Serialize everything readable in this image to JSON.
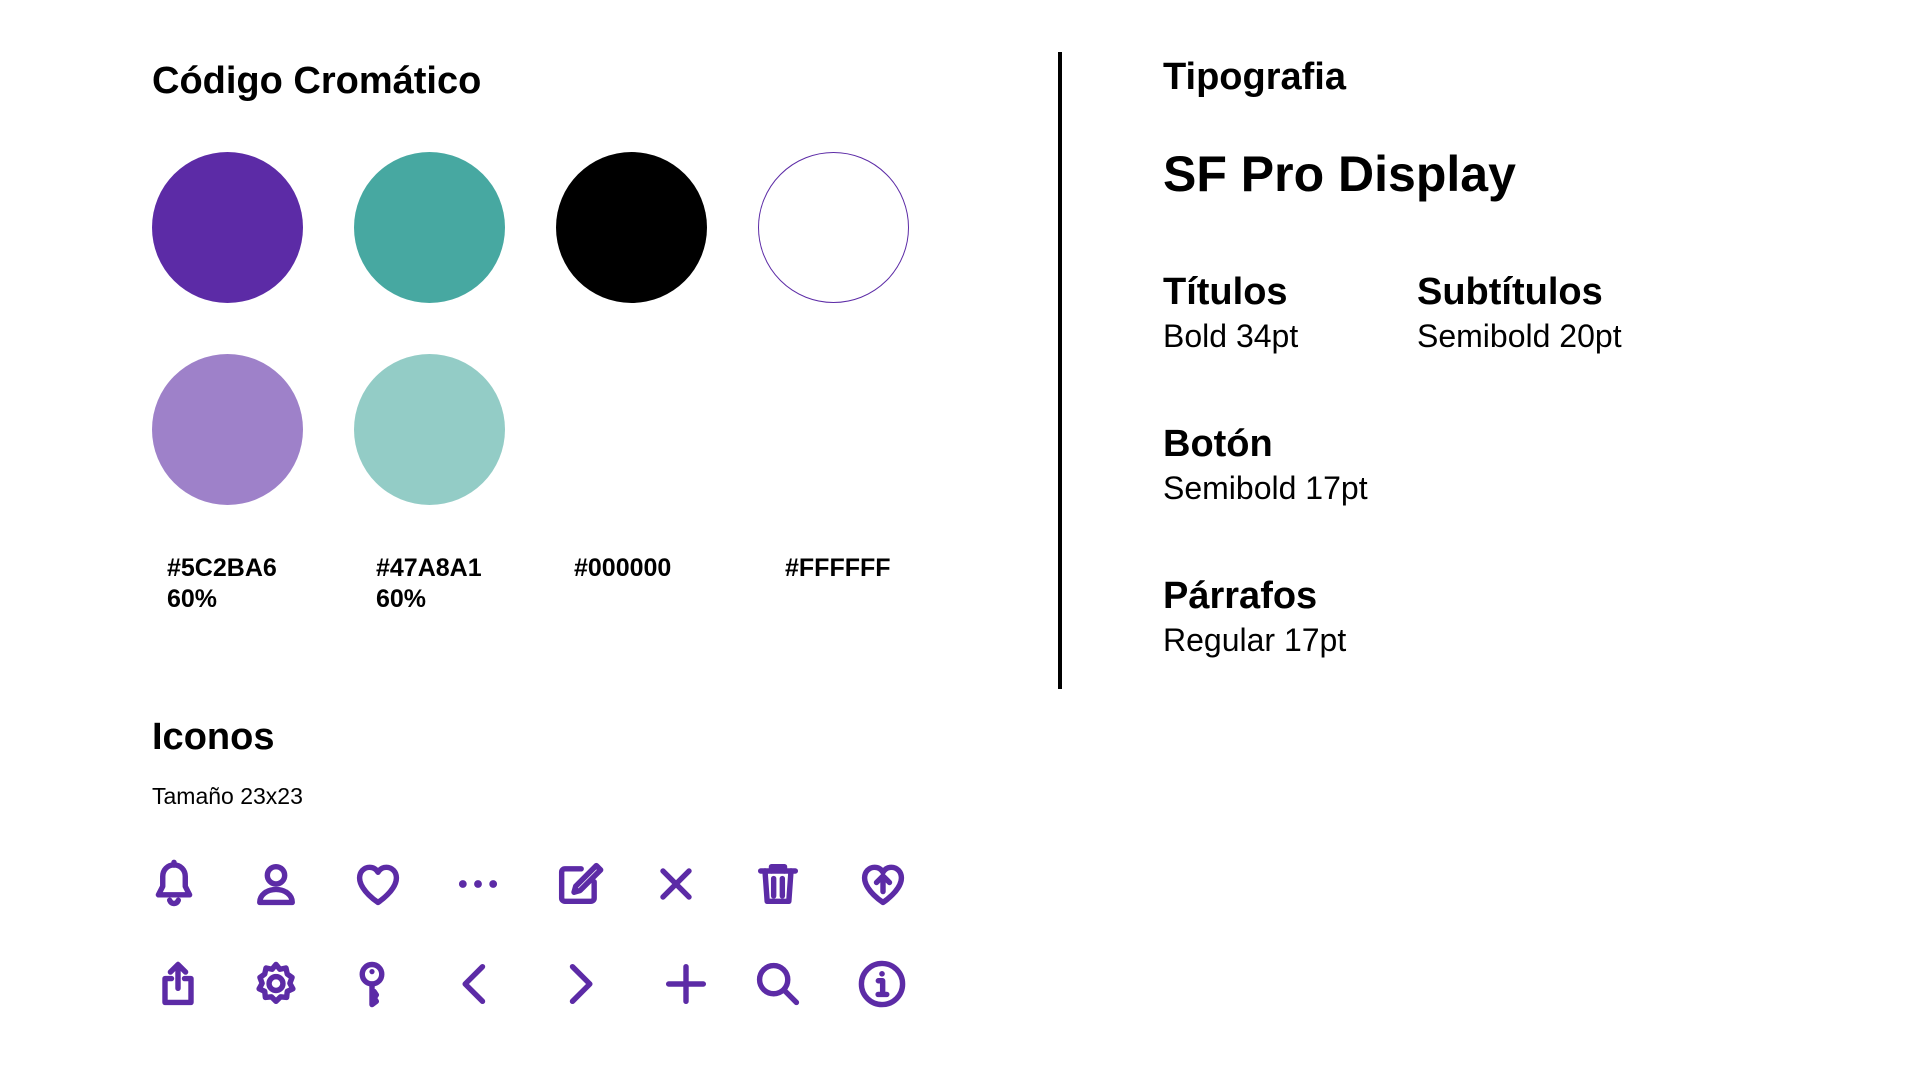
{
  "colors": {
    "title": "Código Cromático",
    "swatches": [
      {
        "name": "purple",
        "color": "#5C2BA6"
      },
      {
        "name": "teal",
        "color": "#47A8A1"
      },
      {
        "name": "black",
        "color": "#000000"
      },
      {
        "name": "white",
        "color": "#FFFFFF"
      },
      {
        "name": "purple-60",
        "color": "#9E81C9"
      },
      {
        "name": "teal-60",
        "color": "#93CCC6"
      }
    ],
    "labels": [
      {
        "hex": "#5C2BA6",
        "opacity": "60%"
      },
      {
        "hex": "#47A8A1",
        "opacity": "60%"
      },
      {
        "hex": "#000000"
      },
      {
        "hex": "#FFFFFF"
      }
    ]
  },
  "typography": {
    "title": "Tipografia",
    "font_name": "SF Pro Display",
    "styles": [
      {
        "name": "Títulos",
        "spec": "Bold 34pt"
      },
      {
        "name": "Subtítulos",
        "spec": "Semibold 20pt"
      },
      {
        "name": "Botón",
        "spec": "Semibold 17pt"
      },
      {
        "name": "Párrafos",
        "spec": "Regular 17pt"
      }
    ]
  },
  "icons": {
    "title": "Iconos",
    "size_label": "Tamaño 23x23",
    "accent": "#5C2BA6",
    "row1": [
      "bell-icon",
      "user-icon",
      "heart-icon",
      "more-icon",
      "edit-icon",
      "close-icon",
      "trash-icon",
      "heart-upload-icon"
    ],
    "row2": [
      "share-icon",
      "gear-icon",
      "key-icon",
      "chevron-left-icon",
      "chevron-right-icon",
      "plus-icon",
      "search-icon",
      "info-icon"
    ]
  }
}
